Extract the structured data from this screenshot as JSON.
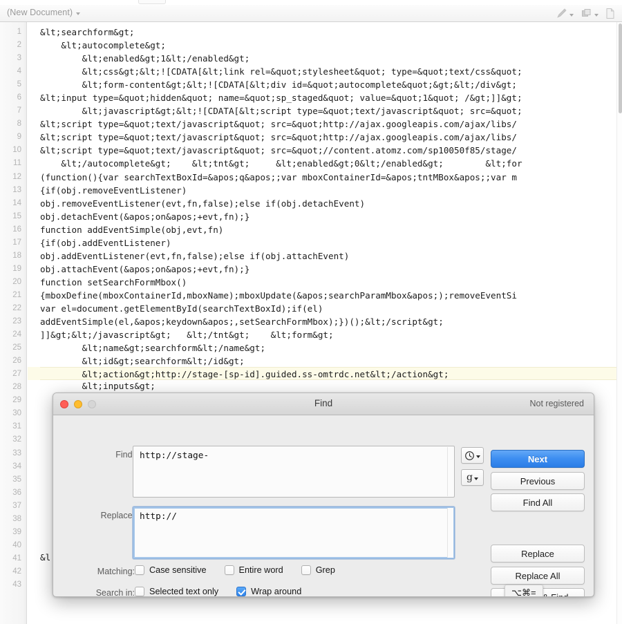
{
  "toolbar": {
    "document_title": "(New Document)",
    "icons": [
      {
        "name": "pen-icon",
        "has_menu": true
      },
      {
        "name": "layers-icon",
        "has_menu": true
      },
      {
        "name": "new-document-icon",
        "has_menu": false
      }
    ]
  },
  "editor": {
    "first_line_number": 1,
    "last_line_number": 43,
    "highlighted_line": 27,
    "lines": [
      "&lt;searchform&gt;",
      "    &lt;autocomplete&gt;",
      "        &lt;enabled&gt;1&lt;/enabled&gt;",
      "        &lt;css&gt;&lt;![CDATA[&lt;link rel=&quot;stylesheet&quot; type=&quot;text/css&quot;",
      "        &lt;form-content&gt;&lt;![CDATA[&lt;div id=&quot;autocomplete&quot;&gt;&lt;/div&gt;",
      "&lt;input type=&quot;hidden&quot; name=&quot;sp_staged&quot; value=&quot;1&quot; /&gt;]]&gt;",
      "        &lt;javascript&gt;&lt;![CDATA[&lt;script type=&quot;text/javascript&quot; src=&quot;",
      "&lt;script type=&quot;text/javascript&quot; src=&quot;http://ajax.googleapis.com/ajax/libs/",
      "&lt;script type=&quot;text/javascript&quot; src=&quot;http://ajax.googleapis.com/ajax/libs/",
      "&lt;script type=&quot;text/javascript&quot; src=&quot;//content.atomz.com/sp10050f85/stage/",
      "    &lt;/autocomplete&gt;    &lt;tnt&gt;     &lt;enabled&gt;0&lt;/enabled&gt;        &lt;for",
      "(function(){var searchTextBoxId=&apos;q&apos;;var mboxContainerId=&apos;tntMBox&apos;;var m",
      "{if(obj.removeEventListener)",
      "obj.removeEventListener(evt,fn,false);else if(obj.detachEvent)",
      "obj.detachEvent(&apos;on&apos;+evt,fn);}",
      "function addEventSimple(obj,evt,fn)",
      "{if(obj.addEventListener)",
      "obj.addEventListener(evt,fn,false);else if(obj.attachEvent)",
      "obj.attachEvent(&apos;on&apos;+evt,fn);}",
      "function setSearchFormMbox()",
      "{mboxDefine(mboxContainerId,mboxName);mboxUpdate(&apos;searchParamMbox&apos;);removeEventSi",
      "var el=document.getElementById(searchTextBoxId);if(el)",
      "addEventSimple(el,&apos;keydown&apos;,setSearchFormMbox);})();&lt;/script&gt;",
      "]]&gt;&lt;/javascript&gt;   &lt;/tnt&gt;    &lt;form&gt;",
      "        &lt;name&gt;searchform&lt;/name&gt;",
      "        &lt;id&gt;searchform&lt;/id&gt;",
      "        &lt;action&gt;http://stage-[sp-id].guided.ss-omtrdc.net&lt;/action&gt;",
      "        &lt;inputs&gt;",
      "",
      "",
      "",
      "",
      "",
      "",
      "",
      "",
      "",
      "",
      "",
      "",
      "&l",
      "",
      ""
    ]
  },
  "find_dialog": {
    "title": "Find",
    "registration_status": "Not registered",
    "find_label": "Find:",
    "find_value": "http://stage-",
    "replace_label": "Replace:",
    "replace_value": "http://",
    "history_button": {
      "name": "history-clock-icon"
    },
    "grep_button": {
      "label": "g"
    },
    "buttons": {
      "next": "Next",
      "previous": "Previous",
      "find_all": "Find All",
      "replace": "Replace",
      "replace_all": "Replace All",
      "replace_and_find": "Replace & Find"
    },
    "matching_label": "Matching:",
    "matching_options": [
      {
        "label": "Case sensitive",
        "checked": false
      },
      {
        "label": "Entire word",
        "checked": false
      },
      {
        "label": "Grep",
        "checked": false
      }
    ],
    "search_in_label": "Search in:",
    "search_in_options": [
      {
        "label": "Selected text only",
        "checked": false
      },
      {
        "label": "Wrap around",
        "checked": true
      }
    ],
    "tooltip": "⌥⌘=",
    "accent_color": "#3d8ef1"
  }
}
